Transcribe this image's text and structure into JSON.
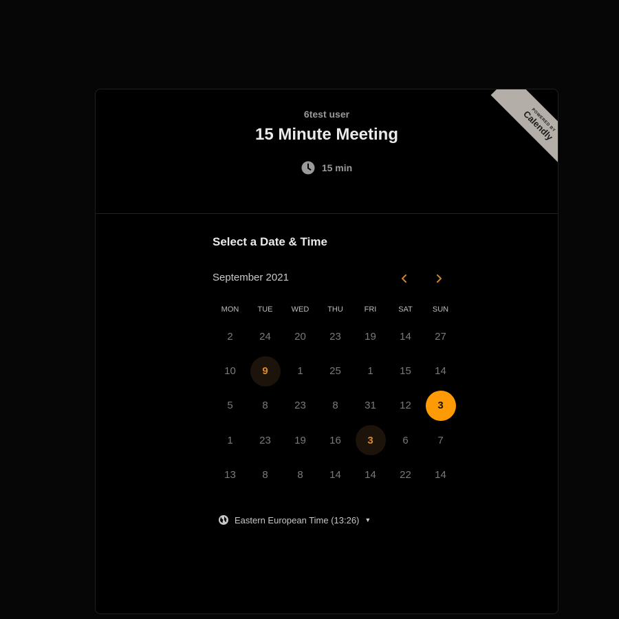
{
  "header": {
    "host_name": "6test user",
    "event_title": "15 Minute Meeting",
    "duration": "15 min",
    "clock_icon": "clock-icon"
  },
  "ribbon": {
    "small_text": "POWERED BY",
    "brand": "Calendly",
    "color": "#b3aea8"
  },
  "calendar": {
    "section_title": "Select a Date & Time",
    "month_label": "September 2021",
    "prev_icon": "chevron-left-icon",
    "next_icon": "chevron-right-icon",
    "weekdays": [
      "MON",
      "TUE",
      "WED",
      "THU",
      "FRI",
      "SAT",
      "SUN"
    ],
    "weeks": [
      [
        {
          "v": "2"
        },
        {
          "v": "24"
        },
        {
          "v": "20"
        },
        {
          "v": "23"
        },
        {
          "v": "19"
        },
        {
          "v": "14"
        },
        {
          "v": "27"
        }
      ],
      [
        {
          "v": "10"
        },
        {
          "v": "9",
          "state": "available"
        },
        {
          "v": "1"
        },
        {
          "v": "25"
        },
        {
          "v": "1"
        },
        {
          "v": "15"
        },
        {
          "v": "14"
        }
      ],
      [
        {
          "v": "5"
        },
        {
          "v": "8"
        },
        {
          "v": "23"
        },
        {
          "v": "8"
        },
        {
          "v": "31"
        },
        {
          "v": "12"
        },
        {
          "v": "3",
          "state": "selected"
        }
      ],
      [
        {
          "v": "1"
        },
        {
          "v": "23"
        },
        {
          "v": "19"
        },
        {
          "v": "16"
        },
        {
          "v": "3",
          "state": "available"
        },
        {
          "v": "6"
        },
        {
          "v": "7"
        }
      ],
      [
        {
          "v": "13"
        },
        {
          "v": "8"
        },
        {
          "v": "8"
        },
        {
          "v": "14"
        },
        {
          "v": "14"
        },
        {
          "v": "22"
        },
        {
          "v": "14"
        }
      ]
    ],
    "accent_color": "#ff9a07"
  },
  "timezone": {
    "label": "Eastern European Time (13:26)",
    "icon": "globe-icon"
  }
}
